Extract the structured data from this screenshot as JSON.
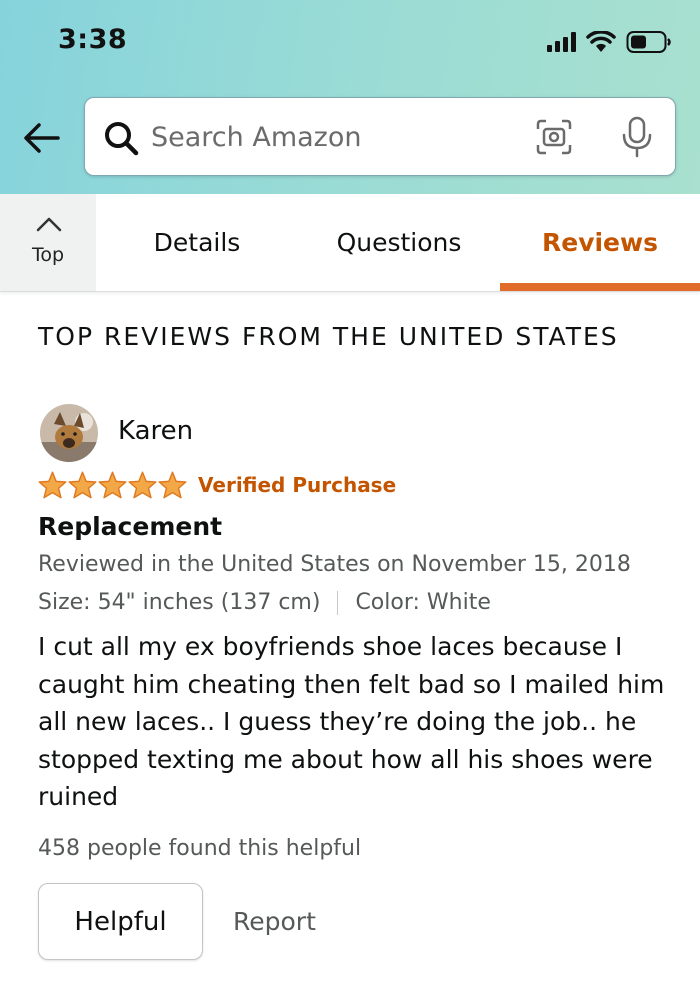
{
  "status_bar": {
    "time": "3:38"
  },
  "search": {
    "placeholder": "Search Amazon"
  },
  "tabs": {
    "top_label": "Top",
    "items": [
      {
        "label": "Details"
      },
      {
        "label": "Questions"
      },
      {
        "label": "Reviews",
        "active": true
      }
    ]
  },
  "section_title": "TOP REVIEWS FROM THE UNITED STATES",
  "review": {
    "reviewer": "Karen",
    "rating": 5,
    "rating_max": 5,
    "verified": "Verified Purchase",
    "title": "Replacement",
    "date_line": "Reviewed in the United States on November 15, 2018",
    "size": "Size: 54\" inches (137 cm)",
    "color": "Color: White",
    "body": "I cut all my ex boyfriends shoe laces because I caught him cheating then felt bad so I mailed him all new laces.. I guess they’re doing the job.. he stopped texting me about how all his shoes were ruined",
    "helpful_count": "458 people found this helpful",
    "helpful_button": "Helpful",
    "report_link": "Report"
  },
  "colors": {
    "accent": "#c45500",
    "tab_underline": "#e06b2a",
    "star": "#f3a847",
    "header_gradient_start": "#86d3dc",
    "header_gradient_end": "#a9e0cf"
  },
  "icons": [
    "back-arrow-icon",
    "search-icon",
    "camera-icon",
    "microphone-icon",
    "chevron-up-icon",
    "signal-icon",
    "wifi-icon",
    "battery-icon",
    "star-icon"
  ]
}
